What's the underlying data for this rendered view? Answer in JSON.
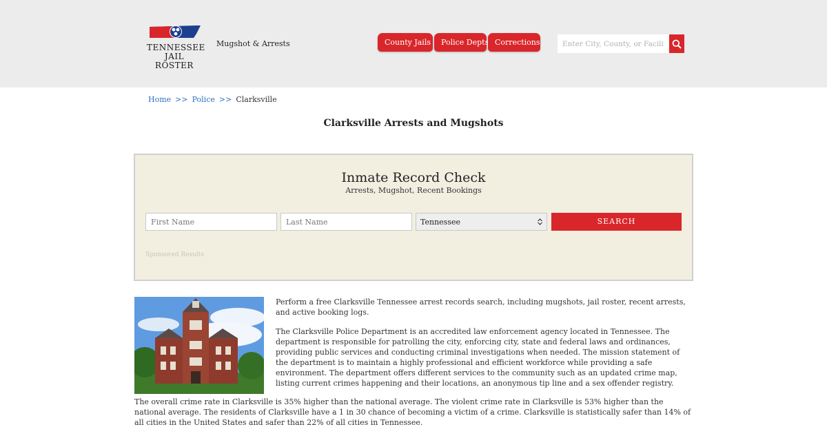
{
  "header": {
    "logo_line1": "TENNESSEE",
    "logo_line2": "JAIL ROSTER",
    "tagline": "Mugshot & Arrests",
    "nav": [
      {
        "label": "County Jails"
      },
      {
        "label": "Police Depts"
      },
      {
        "label": "Corrections"
      }
    ],
    "search_placeholder": "Enter City, County, or Facility"
  },
  "breadcrumb": {
    "home": "Home",
    "sep": ">>",
    "police": "Police",
    "current": "Clarksville"
  },
  "page_title": "Clarksville Arrests and Mugshots",
  "record_check": {
    "title": "Inmate Record Check",
    "subtitle": "Arrests, Mugshot, Recent Bookings",
    "first_placeholder": "First Name",
    "last_placeholder": "Last Name",
    "state_value": "Tennessee",
    "search_label": "SEARCH",
    "sponsored": "Sponsored Results"
  },
  "content": {
    "p1": "Perform a free Clarksville Tennessee arrest records search, including mugshots, jail roster, recent arrests, and active booking logs.",
    "p2": "The Clarksville Police Department is an accredited law enforcement agency located in Tennessee. The department is responsible for patrolling the city, enforcing city, state and federal laws and ordinances, providing public services and conducting criminal investigations when needed. The mission statement of the department is to maintain a highly professional and efficient workforce while providing a safe environment. The department offers different services to the community such as an updated crime map, listing current crimes happening and their locations, an anonymous tip line and a sex offender registry.",
    "p3": "The overall crime rate in Clarksville is 35% higher than the national average. The violent crime rate in Clarksville is 53% higher than the national average. The residents of Clarksville have a 1 in 30 chance of becoming a victim of a crime. Clarksville is statistically safer than 14% of all cities in the United States and safer than 22% of all cities in Tennessee."
  },
  "colors": {
    "accent": "#d9262b",
    "header_bg": "#ececec",
    "panel_bg": "#f2efe1",
    "link": "#2a6fc1"
  }
}
